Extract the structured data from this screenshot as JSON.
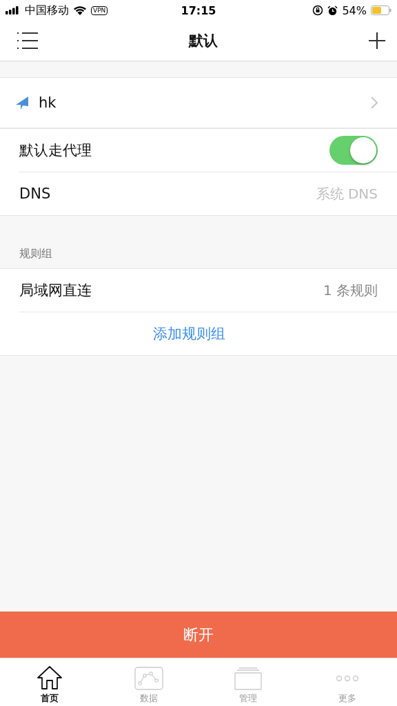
{
  "status_bar": {
    "carrier": "中国移动",
    "vpn": "VPN",
    "time": "17:15",
    "battery": "54%"
  },
  "nav": {
    "title": "默认"
  },
  "server": {
    "name": "hk"
  },
  "settings": [
    {
      "kind": "toggle",
      "label": "默认走代理",
      "on": true
    },
    {
      "kind": "value",
      "label": "DNS",
      "value": "系统 DNS"
    }
  ],
  "rule_groups": {
    "header": "规则组",
    "items": [
      {
        "label": "局域网直连",
        "value": "1 条规则"
      }
    ],
    "add": "添加规则组"
  },
  "disconnect": "断开",
  "tabs": [
    {
      "label": "首页",
      "kind": "home",
      "selected": true
    },
    {
      "label": "数据",
      "kind": "chart",
      "selected": false
    },
    {
      "label": "管理",
      "kind": "stack",
      "selected": false
    },
    {
      "label": "更多",
      "kind": "more",
      "selected": false
    }
  ]
}
